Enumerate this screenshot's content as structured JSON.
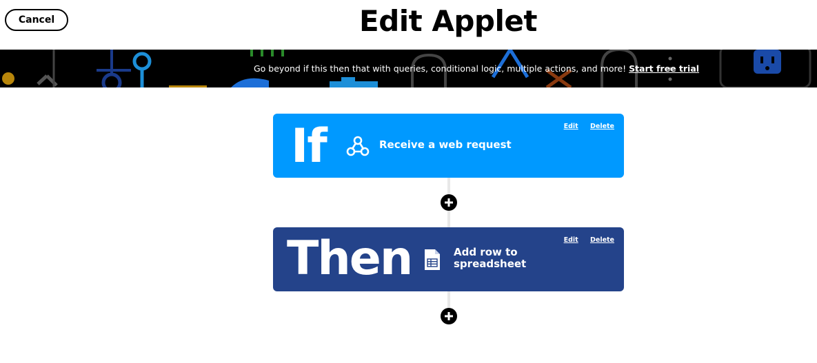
{
  "header": {
    "cancel_label": "Cancel",
    "title": "Edit Applet"
  },
  "banner": {
    "text": "Go beyond if this then that with queries, conditional logic, multiple actions, and more!",
    "link_label": "Start free trial"
  },
  "trigger": {
    "keyword": "If",
    "icon": "webhook-icon",
    "label": "Receive a web request",
    "edit_label": "Edit",
    "delete_label": "Delete",
    "color": "#0099ff"
  },
  "action": {
    "keyword": "Then",
    "icon": "spreadsheet-icon",
    "label": "Add row to spreadsheet",
    "edit_label": "Edit",
    "delete_label": "Delete",
    "color": "#24438a"
  },
  "add_step_icon": "plus-icon"
}
